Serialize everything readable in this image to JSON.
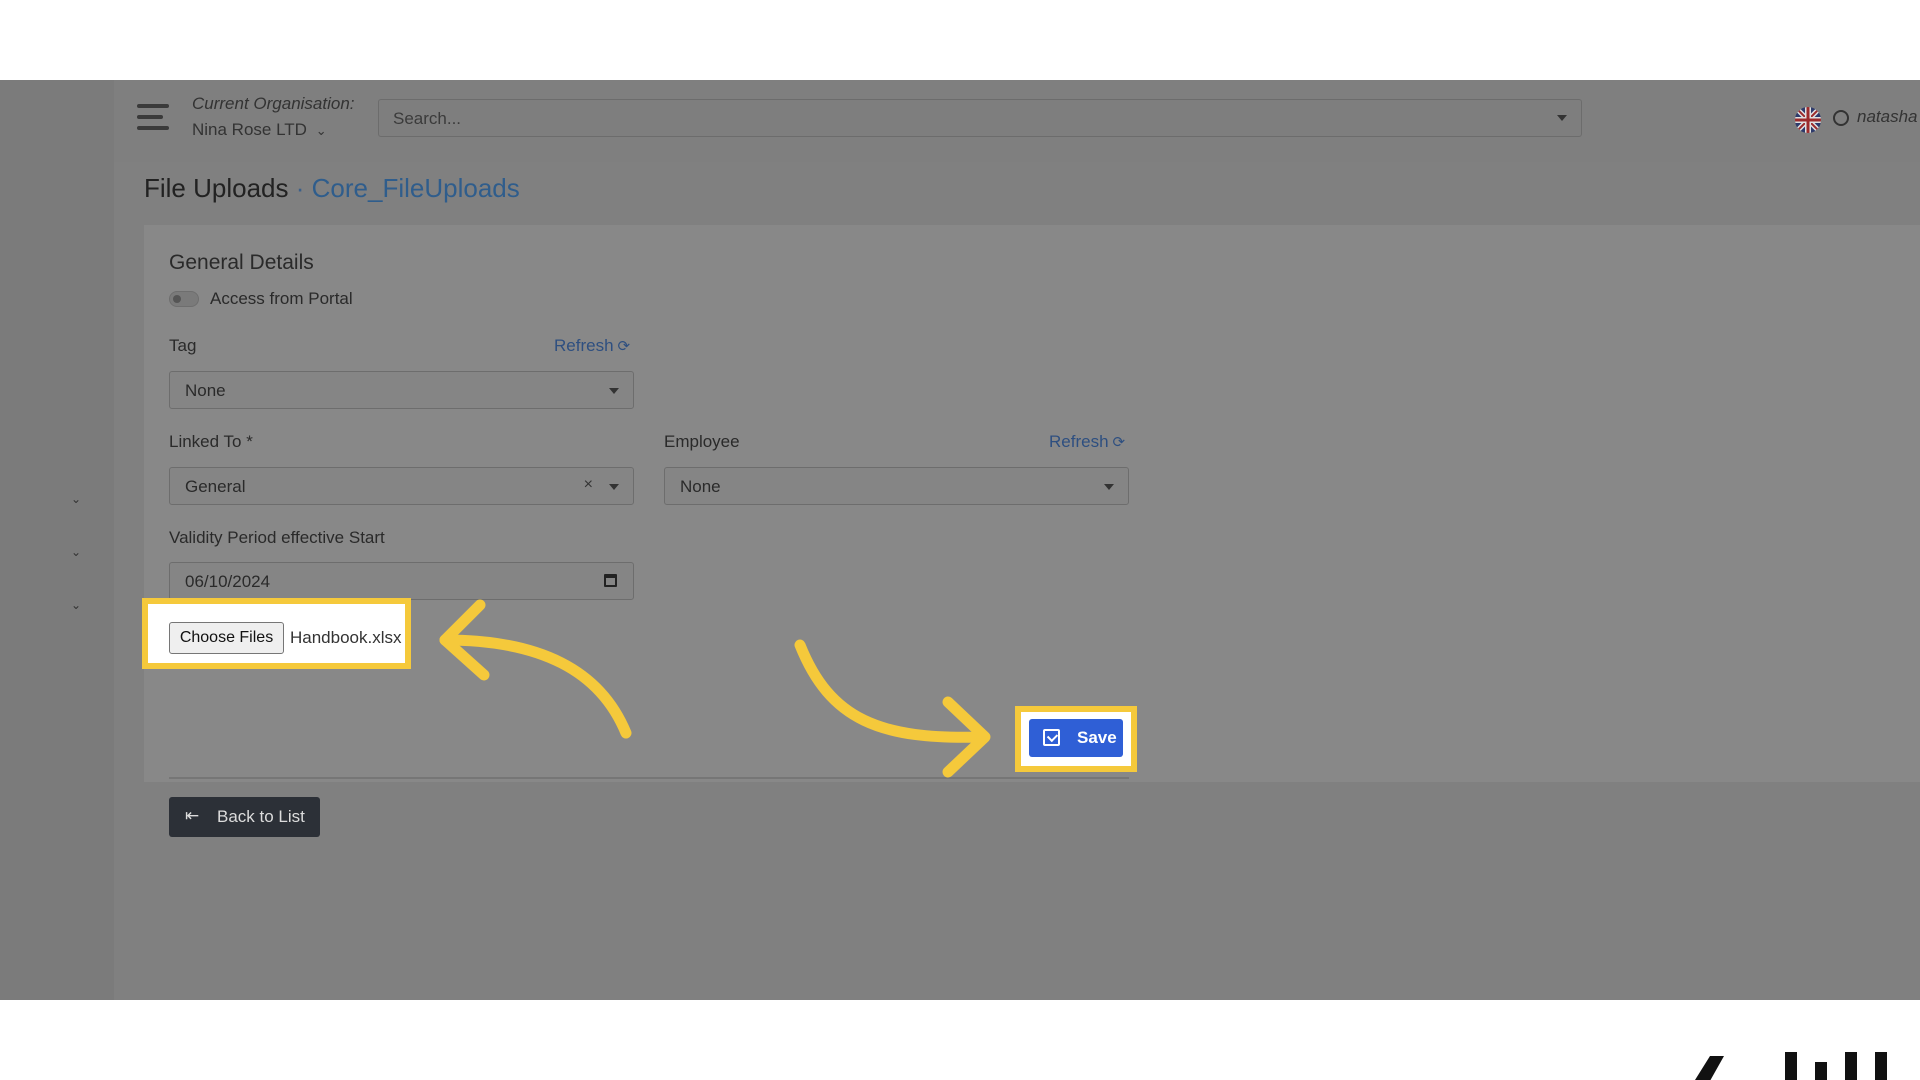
{
  "topbar": {
    "org_label": "Current Organisation:",
    "org_name": "Nina Rose LTD",
    "search_placeholder": "Search...",
    "user_name": "natasha"
  },
  "page": {
    "title": "File Uploads",
    "separator": "·",
    "subtitle": "Core_FileUploads"
  },
  "form": {
    "section_title": "General Details",
    "access_toggle_label": "Access from Portal",
    "access_toggle_on": false,
    "tag_label": "Tag",
    "tag_value": "None",
    "refresh_label": "Refresh",
    "linked_to_label": "Linked To *",
    "linked_to_value": "General",
    "employee_label": "Employee",
    "employee_value": "None",
    "validity_label": "Validity Period effective Start",
    "validity_value": "06/10/2024",
    "choose_files_label": "Choose Files",
    "file_name": "Handbook.xlsx"
  },
  "actions": {
    "back_label": "Back to List",
    "save_label": "Save"
  },
  "colors": {
    "highlight": "#f5c93b",
    "save_button": "#2f5fd6",
    "back_button": "#2c3037",
    "link": "#2e4f80"
  }
}
